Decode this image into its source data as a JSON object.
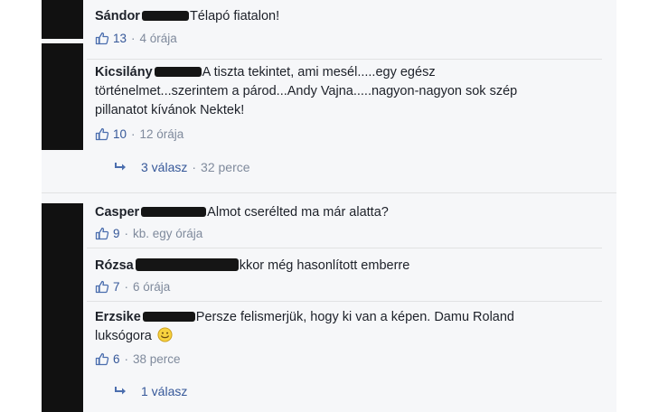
{
  "comments": [
    {
      "author": "Sándor",
      "text": "Télapó fiatalon!",
      "likes": "13",
      "time": "4 órája"
    },
    {
      "author": "Kicsilány",
      "text_line1": "A tiszta tekintet, ami mesél.....egy egész",
      "text_line2": "történelmet...szerintem a párod...Andy Vajna.....nagyon-nagyon sok szép",
      "text_line3": "pillanatot kívánok Nektek!",
      "likes": "10",
      "time": "12 órája",
      "replies": {
        "label": "3 válasz",
        "time": "32 perce"
      }
    },
    {
      "author": "Casper",
      "text": "Almot cserélted ma már alatta?",
      "likes": "9",
      "time": "kb. egy órája"
    },
    {
      "author": "Rózsa",
      "text": "kkor még hasonlított emberre",
      "likes": "7",
      "time": "6 órája"
    },
    {
      "author": "Erzsike",
      "text_line1": "Persze felismerjük, hogy ki van a képen. Damu Roland",
      "text_line2": "luksógora",
      "likes": "6",
      "time": "38 perce",
      "replies": {
        "label": "1 válasz"
      }
    }
  ],
  "separator": "·",
  "icons": {
    "like": "thumbs-up-icon",
    "reply": "reply-arrow-icon",
    "emoji": "smiley-face-icon"
  },
  "colors": {
    "link": "#365899",
    "meta": "#7f8a9c",
    "panel_bg": "#f6f7f9",
    "redaction": "#151515"
  }
}
